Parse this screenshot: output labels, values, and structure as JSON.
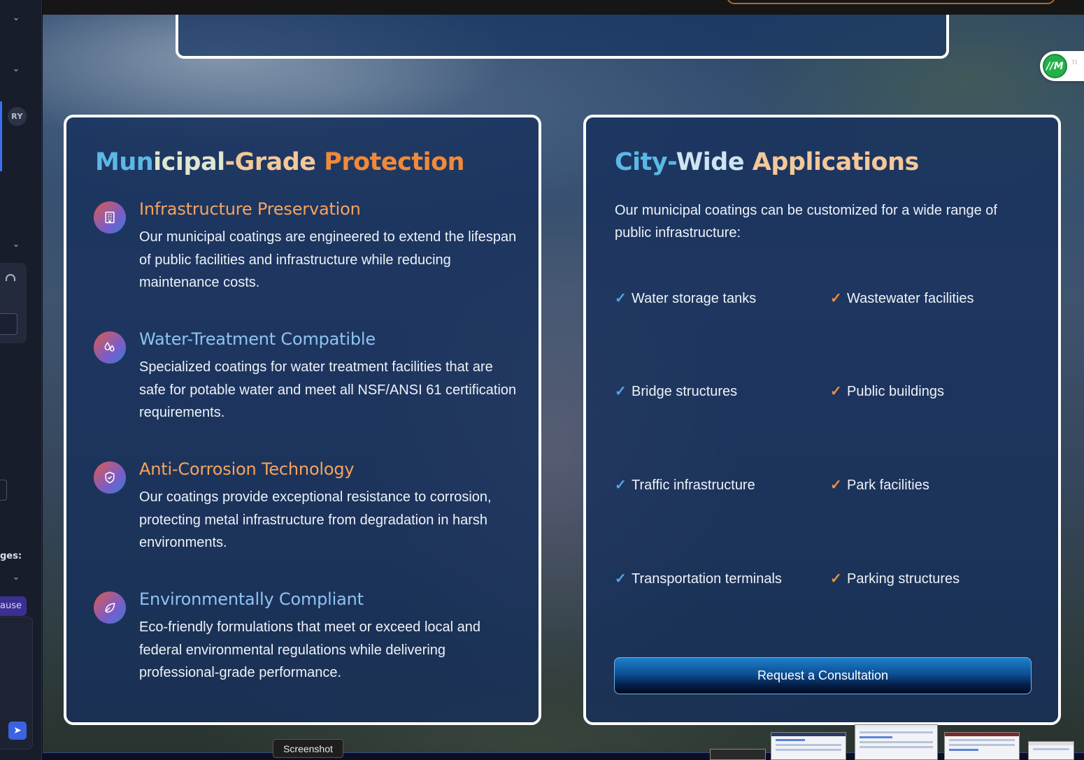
{
  "sidebar": {
    "avatar_initials": "RY",
    "ges_label": "ges:",
    "pause_label": "ause"
  },
  "left_card": {
    "title_parts": [
      "Mun",
      "icipal",
      "-Grade",
      " Protection"
    ],
    "features": [
      {
        "icon": "building-icon",
        "title": "Infrastructure Preservation",
        "text": "Our municipal coatings are engineered to extend the lifespan of public facilities and infrastructure while reducing maintenance costs."
      },
      {
        "icon": "droplets-icon",
        "title": "Water-Treatment Compatible",
        "text": "Specialized coatings for water treatment facilities that are safe for potable water and meet all NSF/ANSI 61 certification requirements."
      },
      {
        "icon": "shield-check-icon",
        "title": "Anti-Corrosion Technology",
        "text": "Our coatings provide exceptional resistance to corrosion, protecting metal infrastructure from degradation in harsh environments."
      },
      {
        "icon": "leaf-icon",
        "title": "Environmentally Compliant",
        "text": "Eco-friendly formulations that meet or exceed local and federal environmental regulations while delivering professional-grade performance."
      }
    ]
  },
  "right_card": {
    "title_parts": [
      "City-",
      "Wide",
      " Applications"
    ],
    "intro": "Our municipal coatings can be customized for a wide range of public infrastructure:",
    "check_glyph": "✓",
    "applications": [
      "Water storage tanks",
      "Wastewater facilities",
      "Bridge structures",
      "Public buildings",
      "Traffic infrastructure",
      "Park facilities",
      "Transportation terminals",
      "Parking structures"
    ],
    "cta_label": "Request a Consultation"
  },
  "widget": {
    "logo_text": "//M"
  },
  "dock": {
    "tooltip": "Screenshot"
  },
  "colors": {
    "title_blue": "#5cb8e6",
    "title_orange": "#f08a3a",
    "check_blue": "#4fa8e8",
    "check_orange": "#f0903c",
    "card_border": "#ffffff"
  }
}
